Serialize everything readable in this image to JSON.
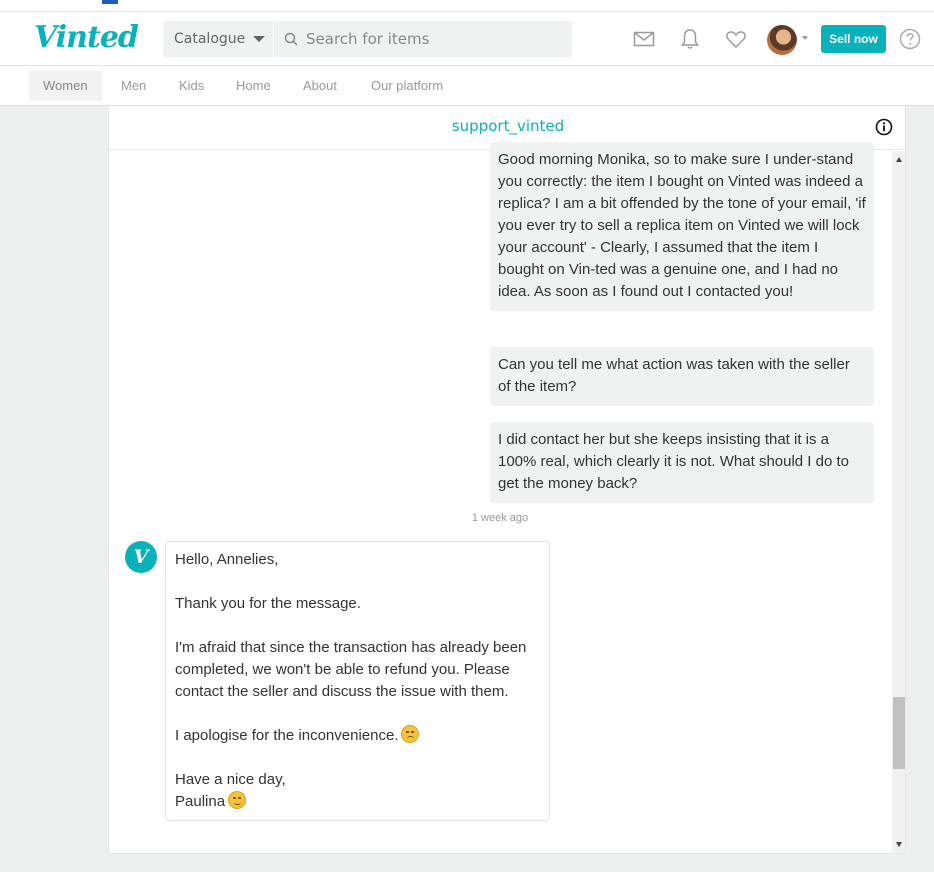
{
  "header": {
    "logo": "Vinted",
    "catalogue_label": "Catalogue",
    "search_placeholder": "Search for items",
    "sell_label": "Sell now",
    "brand_color": "#09b1ba",
    "icons": [
      "mail-icon",
      "bell-icon",
      "heart-icon",
      "avatar",
      "help-icon"
    ]
  },
  "nav": {
    "items": [
      {
        "label": "Women"
      },
      {
        "label": "Men"
      },
      {
        "label": "Kids"
      },
      {
        "label": "Home"
      },
      {
        "label": "About"
      },
      {
        "label": "Our platform"
      }
    ]
  },
  "conversation": {
    "title": "support_vinted",
    "outgoing": [
      "Good morning Monika, so to make sure I under-stand you correctly: the item I bought on Vinted was indeed a replica? I am a bit offended by the tone of your email, 'if you ever try to sell a replica item on Vinted we will lock your account' - Clearly, I assumed that the item I bought on Vin-ted was a genuine one, and I had no idea. As soon as I found out I contacted you!",
      "Can you tell me what action was taken with the seller of the item?",
      "I did contact her but she keeps insisting that it is a 100% real, which clearly it is not. What should I do to get the money back?"
    ],
    "timestamp": "1 week ago",
    "support_avatar_letter": "V",
    "incoming": {
      "greeting": "Hello, Annelies,",
      "thanks": "Thank you for the message.",
      "body": "I'm afraid that since the transaction has already been completed, we won't be able to refund you. Please contact the seller and discuss the issue with them.",
      "apology": "I apologise for the inconvenience.",
      "closing": "Have a nice day,",
      "signature": "Paulina"
    }
  }
}
